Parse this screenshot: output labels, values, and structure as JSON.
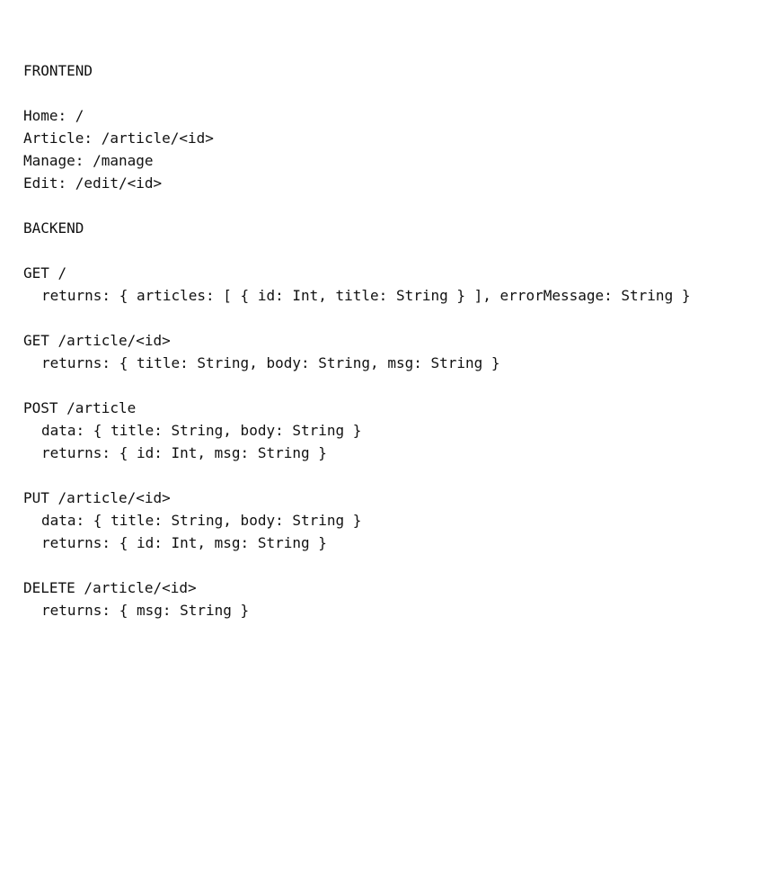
{
  "frontend": {
    "heading": "FRONTEND",
    "routes": [
      {
        "text": "Home: /"
      },
      {
        "text": "Article: /article/<id>"
      },
      {
        "text": "Manage: /manage"
      },
      {
        "text": "Edit: /edit/<id>"
      }
    ]
  },
  "backend": {
    "heading": "BACKEND",
    "endpoints": [
      {
        "signature": "GET /",
        "returns": "returns: { articles: [ { id: Int, title: String } ], errorMessage: String }"
      },
      {
        "signature": "GET /article/<id>",
        "returns": "returns: { title: String, body: String, msg: String }"
      },
      {
        "signature": "POST /article",
        "data": "data: { title: String, body: String }",
        "returns": "returns: { id: Int, msg: String }"
      },
      {
        "signature": "PUT /article/<id>",
        "data": "data: { title: String, body: String }",
        "returns": "returns: { id: Int, msg: String }"
      },
      {
        "signature": "DELETE /article/<id>",
        "returns": "returns: { msg: String }"
      }
    ]
  }
}
